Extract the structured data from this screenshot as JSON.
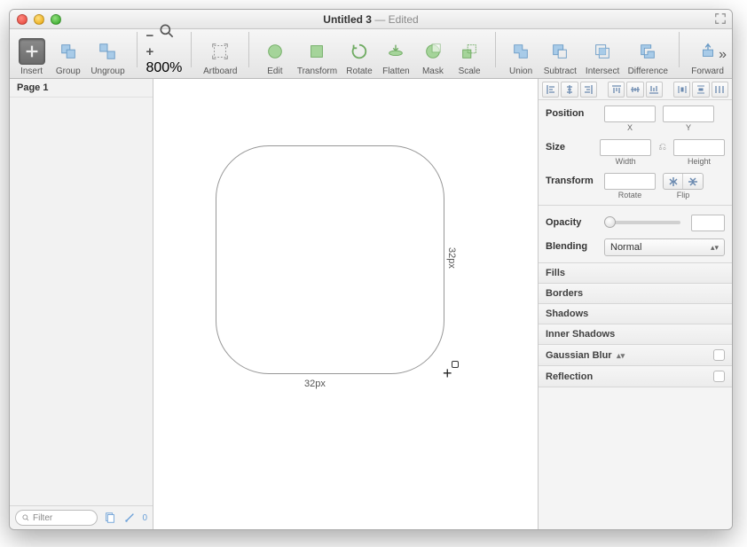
{
  "window": {
    "title": "Untitled 3",
    "status": "Edited"
  },
  "toolbar": {
    "insert": "Insert",
    "group": "Group",
    "ungroup": "Ungroup",
    "zoom": "800%",
    "artboard": "Artboard",
    "edit": "Edit",
    "transform": "Transform",
    "rotate": "Rotate",
    "flatten": "Flatten",
    "mask": "Mask",
    "scale": "Scale",
    "union": "Union",
    "subtract": "Subtract",
    "intersect": "Intersect",
    "difference": "Difference",
    "forward": "Forward"
  },
  "sidebar": {
    "page": "Page 1",
    "filter_placeholder": "Filter",
    "slice_count": "0"
  },
  "canvas": {
    "width_label": "32px",
    "height_label": "32px"
  },
  "inspector": {
    "position": "Position",
    "x": "X",
    "y": "Y",
    "size": "Size",
    "width": "Width",
    "height": "Height",
    "transform": "Transform",
    "rotate": "Rotate",
    "flip": "Flip",
    "opacity": "Opacity",
    "blending": "Blending",
    "blending_value": "Normal",
    "fills": "Fills",
    "borders": "Borders",
    "shadows": "Shadows",
    "inner_shadows": "Inner Shadows",
    "gaussian": "Gaussian Blur",
    "reflection": "Reflection"
  }
}
